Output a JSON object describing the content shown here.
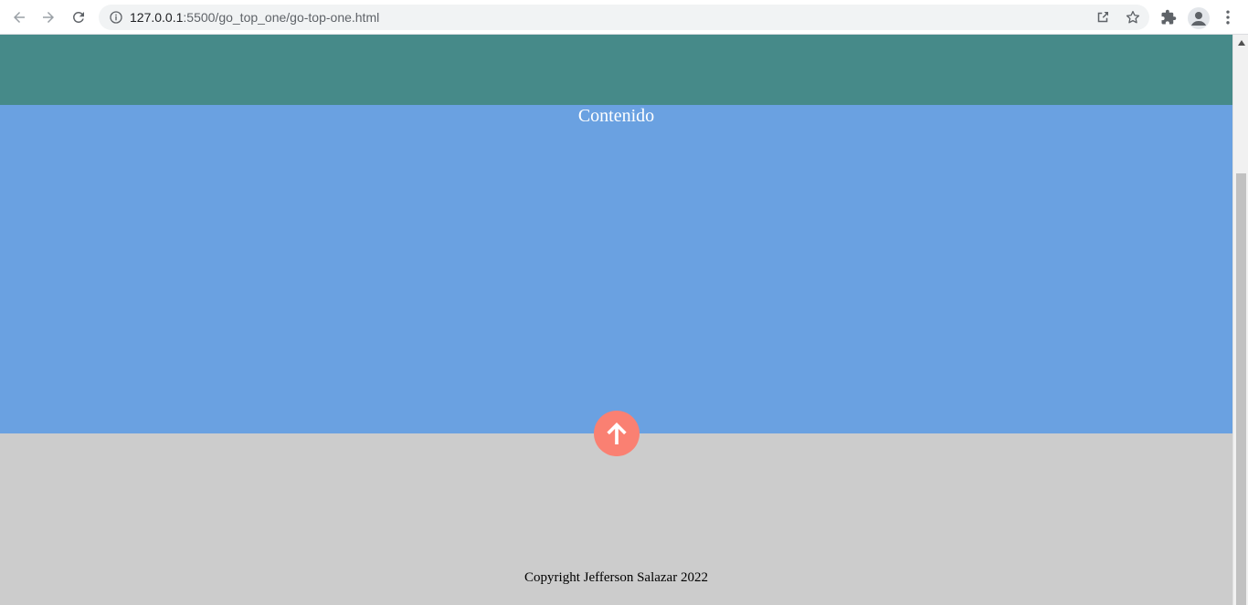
{
  "browser": {
    "url_host": "127.0.0.1",
    "url_rest": ":5500/go_top_one/go-top-one.html",
    "icons": {
      "back": "back-arrow-icon",
      "forward": "forward-arrow-icon",
      "reload": "reload-icon",
      "info": "info-icon",
      "share": "share-icon",
      "bookmark": "star-icon",
      "extensions": "puzzle-icon",
      "profile": "profile-icon",
      "menu": "kebab-menu-icon"
    }
  },
  "page": {
    "content_title": "Contenido",
    "copyright": "Copyright Jefferson Salazar 2022",
    "go_top_icon": "arrow-up-icon"
  },
  "colors": {
    "header": "#468a89",
    "content": "#6aa1e1",
    "footer": "#cccccc",
    "go_top": "#fa8072"
  }
}
